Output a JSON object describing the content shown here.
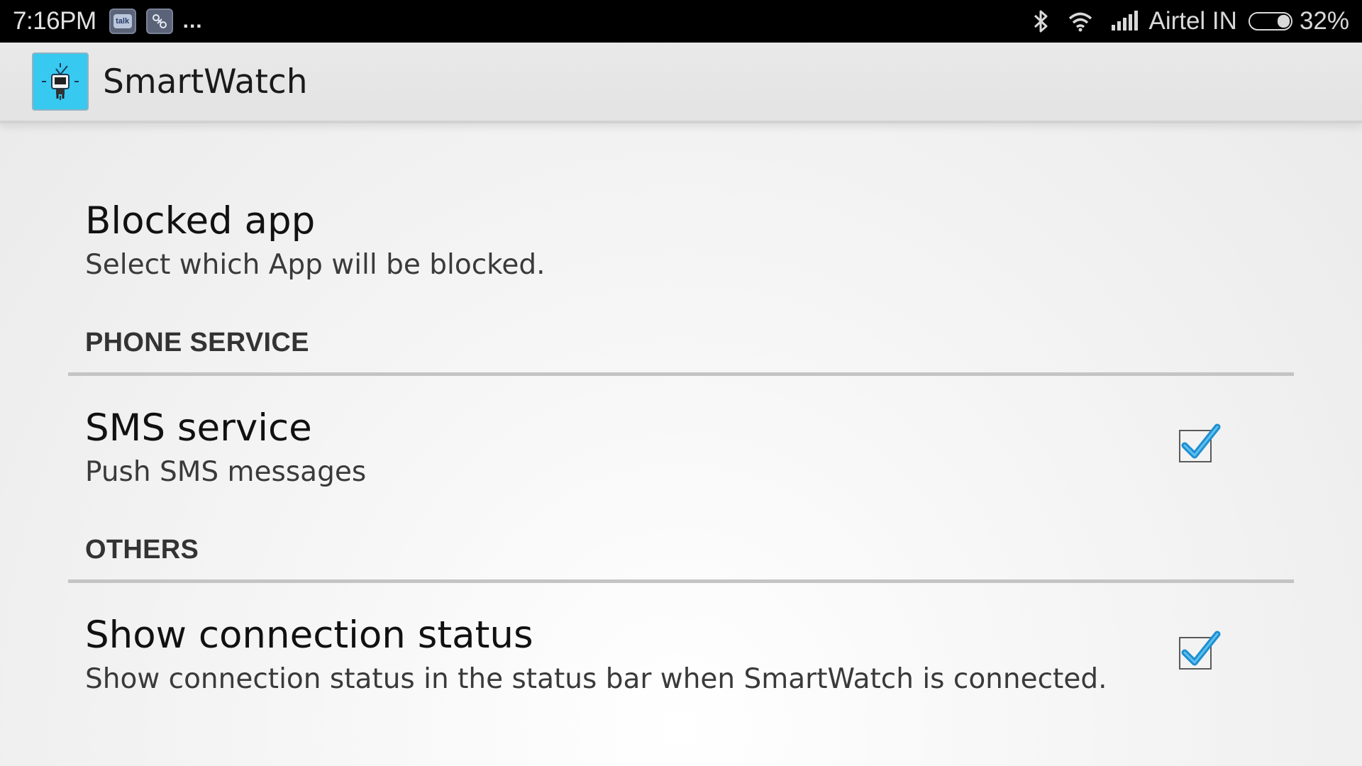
{
  "status_bar": {
    "time": "7:16PM",
    "notif_talk_label": "talk",
    "more_indicator": "...",
    "carrier": "Airtel IN",
    "battery_percent": "32%",
    "battery_level": 0.32,
    "icons": [
      "talk-notification-icon",
      "app-notification-icon",
      "bluetooth-icon",
      "wifi-icon",
      "signal-icon",
      "battery-icon"
    ]
  },
  "action_bar": {
    "title": "SmartWatch",
    "icon": "smartwatch-app-icon"
  },
  "preferences": {
    "blocked_app": {
      "title": "Blocked app",
      "summary": "Select which App will be blocked."
    },
    "sections": [
      {
        "header": "PHONE SERVICE",
        "items": [
          {
            "title": "SMS service",
            "summary": "Push SMS messages",
            "checked": true
          }
        ]
      },
      {
        "header": "OTHERS",
        "items": [
          {
            "title": "Show connection status",
            "summary": "Show connection status in the status bar when SmartWatch is connected.",
            "checked": true
          }
        ]
      }
    ]
  },
  "colors": {
    "status_bar_bg": "#000000",
    "action_bar_bg": "#e6e6e6",
    "app_icon_bg": "#37c9ef",
    "checkmark": "#1e8fd0",
    "divider": "#c4c4c4"
  }
}
